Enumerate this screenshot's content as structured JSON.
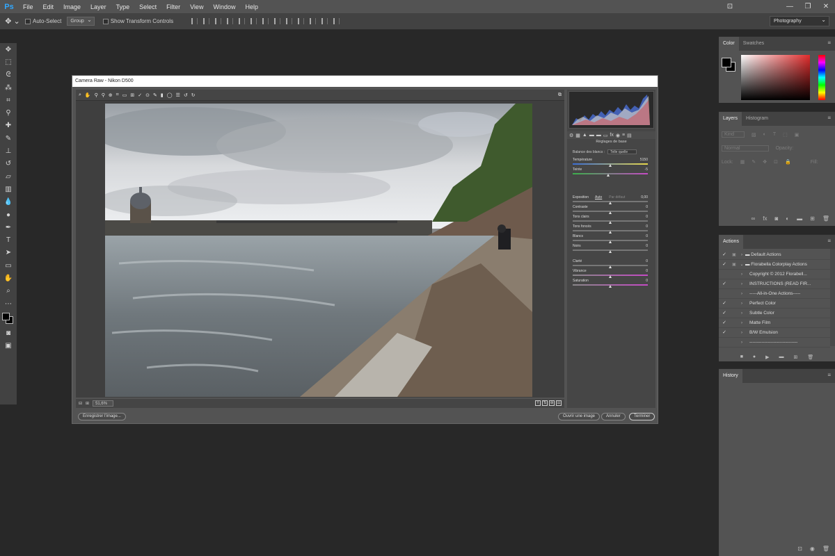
{
  "menubar": {
    "logo": "Ps",
    "items": [
      "File",
      "Edit",
      "Image",
      "Layer",
      "Type",
      "Select",
      "Filter",
      "View",
      "Window",
      "Help"
    ],
    "win_minimize": "—",
    "win_maximize": "❐",
    "win_close": "✕"
  },
  "options": {
    "auto_select": "Auto-Select",
    "group": "Group",
    "show_transform": "Show Transform Controls",
    "workspace": "Photography"
  },
  "document": {
    "title": "Camera Raw -   Nikon D500",
    "zoom": "51,6%",
    "save_button": "Enregistrer l'image...",
    "open_button": "Ouvrir une image",
    "cancel_button": "Annuler",
    "done_button": "Terminer"
  },
  "camera_raw_panel": {
    "title": "Réglages de base",
    "white_balance_label": "Balance des blancs :",
    "white_balance_value": "Telle quelle",
    "auto": "Auto",
    "default": "Par défaut",
    "sliders": [
      {
        "label": "Température",
        "value": "5150",
        "pos": 0.5
      },
      {
        "label": "Teinte",
        "value": "-5",
        "pos": 0.48
      },
      {
        "label": "Exposition",
        "value": "0,00",
        "pos": 0.5
      },
      {
        "label": "Contraste",
        "value": "0",
        "pos": 0.5
      },
      {
        "label": "Tons clairs",
        "value": "0",
        "pos": 0.5
      },
      {
        "label": "Tons foncés",
        "value": "0",
        "pos": 0.5
      },
      {
        "label": "Blancs",
        "value": "0",
        "pos": 0.5
      },
      {
        "label": "Noirs",
        "value": "0",
        "pos": 0.5
      },
      {
        "label": "Clarté",
        "value": "0",
        "pos": 0.5
      },
      {
        "label": "Vibrance",
        "value": "0",
        "pos": 0.5
      },
      {
        "label": "Saturation",
        "value": "0",
        "pos": 0.5
      }
    ]
  },
  "color_panel": {
    "tab_color": "Color",
    "tab_swatches": "Swatches"
  },
  "layers_panel": {
    "tab_layers": "Layers",
    "tab_histogram": "Histogram",
    "kind_placeholder": "Kind",
    "blend_mode": "Normal",
    "opacity_label": "Opacity:",
    "lock_label": "Lock:",
    "fill_label": "Fill:"
  },
  "actions_panel": {
    "tab": "Actions",
    "rows": [
      {
        "check": "✓",
        "box": "▣",
        "exp": "›",
        "label": "Default Actions",
        "folder": true
      },
      {
        "check": "✓",
        "box": "▣",
        "exp": "⌄",
        "label": "Florabella Colorplay Actions",
        "folder": true
      },
      {
        "check": "",
        "box": "",
        "exp": "›",
        "label": "Copyright © 2012 Florabell...",
        "folder": false
      },
      {
        "check": "✓",
        "box": "",
        "exp": "›",
        "label": "INSTRUCTIONS (READ FIR...",
        "folder": false
      },
      {
        "check": "",
        "box": "",
        "exp": "›",
        "label": "-----All-in-One Actions-----",
        "folder": false
      },
      {
        "check": "✓",
        "box": "",
        "exp": "›",
        "label": "Perfect Color",
        "folder": false
      },
      {
        "check": "✓",
        "box": "",
        "exp": "›",
        "label": "Subtle Color",
        "folder": false
      },
      {
        "check": "✓",
        "box": "",
        "exp": "›",
        "label": "Matte Film",
        "folder": false
      },
      {
        "check": "✓",
        "box": "",
        "exp": "›",
        "label": "B/W Emulsion",
        "folder": false
      },
      {
        "check": "",
        "box": "",
        "exp": "›",
        "label": "--------------------------------",
        "folder": false
      }
    ]
  },
  "history_panel": {
    "tab": "History"
  }
}
